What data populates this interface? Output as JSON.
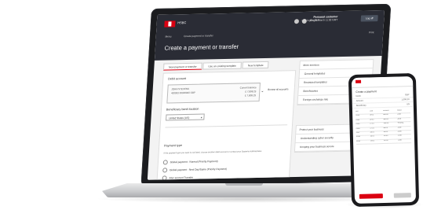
{
  "app": {
    "logo_text": "HSBC",
    "menu": "Menu",
    "breadcrumb": "Create payment or transfer",
    "title": "Create a payment or transfer",
    "language": "English",
    "user_name": "Personal customer",
    "user_sub": "Last logon: 26 March 11:30 GMT",
    "logoff": "Log off",
    "print": "Print"
  },
  "tabs": [
    {
      "label": "New payment or transfer",
      "active": true
    },
    {
      "label": "Use an existing template",
      "active": false
    },
    {
      "label": "New template",
      "active": false
    }
  ],
  "form": {
    "debit_label": "Debit account",
    "debit_name": "JOHN STEVENS",
    "debit_number": "400000 00000000 GBP",
    "debit_balance_label": "Current balance",
    "debit_balance": "£ 7,808.29",
    "debit_available": "£ 7,808.29",
    "browse_accounts": "Browse all accounts",
    "beneficiary_label": "Beneficiary bank location",
    "beneficiary_value": "United States (US)",
    "payment_type_label": "Payment type",
    "payment_type_desc": "If the payment type you want is not listed, choose another debit account or contact your Systems Administrator.",
    "payment_options": [
      "Global payment - Normal (Priority Payment)",
      "Global payment - Next Day/Same (Priority Payment)",
      "Inter account Transfer"
    ]
  },
  "side": {
    "header": "More services",
    "items": [
      "General templates",
      "Restricted templates",
      "Beneficiaries",
      "Foreign exchange rate"
    ],
    "header2": "Protect your business",
    "items2": [
      "Understanding cyber security",
      "Keeping your business secure"
    ]
  },
  "phone": {
    "title": "Create a payment",
    "rows": [
      {
        "label": "Debit",
        "value": "GBP"
      },
      {
        "label": "Amount",
        "value": "1,000.00"
      },
      {
        "label": "Beneficiary",
        "value": "US"
      }
    ],
    "grid": [
      "Ref",
      "Date",
      "Amount",
      "Status",
      "0123",
      "26/03",
      "500.00",
      "Done",
      "0124",
      "26/03",
      "300.00",
      "Done",
      "0125",
      "27/03",
      "120.00",
      "Pending",
      "0126",
      "27/03",
      "80.00",
      "Done",
      "0127",
      "28/03",
      "60.00",
      "Done",
      "0128",
      "28/03",
      "40.00",
      "Done",
      "0129",
      "29/03",
      "20.00",
      "Done"
    ]
  },
  "colors": {
    "brand_red": "#db0011",
    "header_dark": "#2a2c35"
  }
}
